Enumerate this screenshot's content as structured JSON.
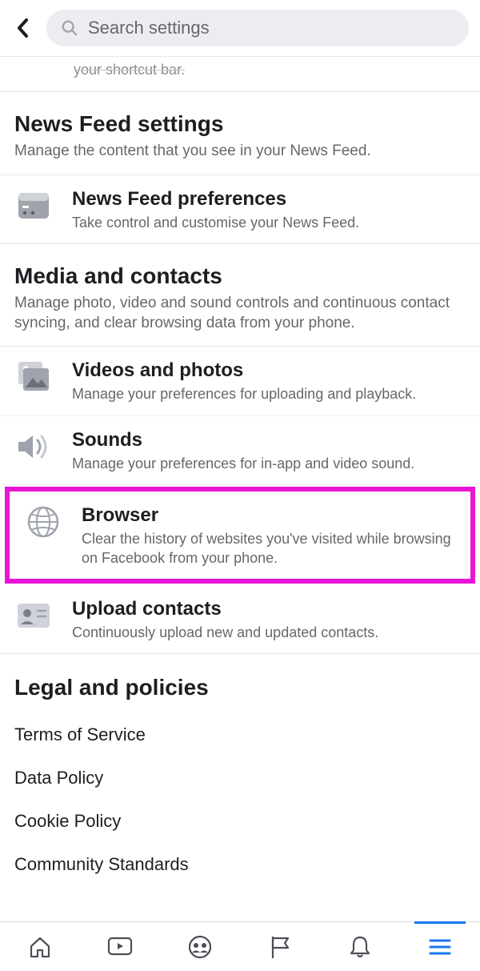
{
  "header": {
    "search_placeholder": "Search settings"
  },
  "truncated": "your shortcut bar.",
  "sections": {
    "newsfeed": {
      "title": "News Feed settings",
      "subtitle": "Manage the content that you see in your News Feed.",
      "items": {
        "preferences": {
          "title": "News Feed preferences",
          "desc": "Take control and customise your News Feed."
        }
      }
    },
    "media": {
      "title": "Media and contacts",
      "subtitle": "Manage photo, video and sound controls and continuous contact syncing, and clear browsing data from your phone.",
      "items": {
        "videos": {
          "title": "Videos and photos",
          "desc": "Manage your preferences for uploading and playback."
        },
        "sounds": {
          "title": "Sounds",
          "desc": "Manage your preferences for in-app and video sound."
        },
        "browser": {
          "title": "Browser",
          "desc": "Clear the history of websites you've visited while browsing on Facebook from your phone."
        },
        "upload": {
          "title": "Upload contacts",
          "desc": "Continuously upload new and updated contacts."
        }
      }
    },
    "legal": {
      "title": "Legal and policies",
      "links": {
        "terms": "Terms of Service",
        "data": "Data Policy",
        "cookie": "Cookie Policy",
        "community": "Community Standards"
      }
    }
  }
}
